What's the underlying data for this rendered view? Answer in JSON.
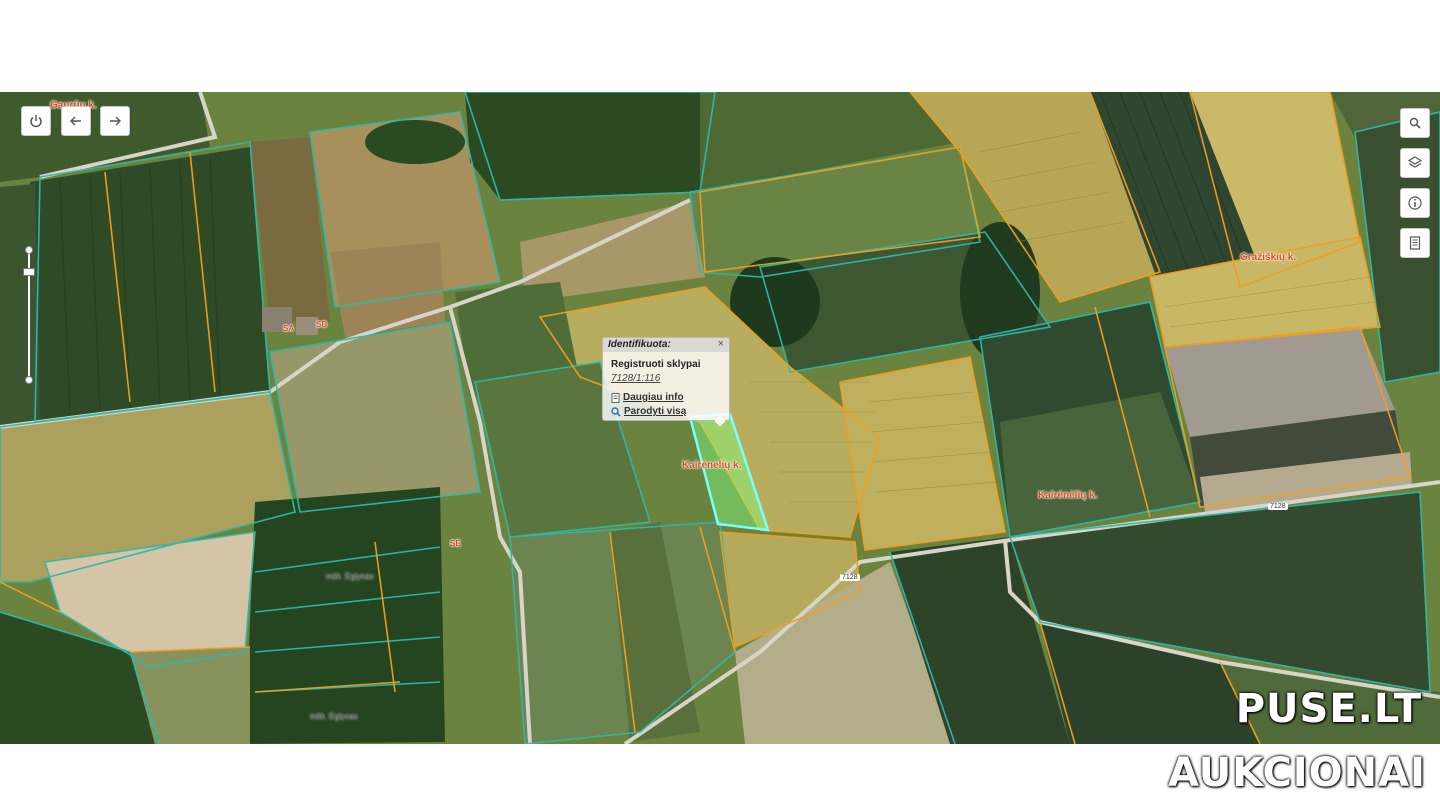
{
  "popup": {
    "header": "Identifikuota:",
    "close": "×",
    "title": "Registruoti sklypai",
    "parcel_id": "7128/1:116",
    "link_more": "Daugiau info",
    "link_show_all": "Parodyti visą"
  },
  "labels": {
    "village_top_left": "Gaurūų k.",
    "grazisku": "Gražiškių k.",
    "kairenelu_center": "Kairėnėlių k.",
    "kairenelu_right": "Kairėnėlių k.",
    "forest_1": "mšk. Eglynas",
    "forest_2": "mšk. Eglynas",
    "road_7128_a": "7128",
    "road_7128_b": "7128",
    "marker_a": "SA",
    "marker_b": "SB",
    "marker_c": "SE"
  },
  "brand": {
    "line1": "PUSE.LT",
    "line2": "AUKCIONAI"
  },
  "colors": {
    "parcel_border": "#2fb8a8",
    "cadastre_orange": "#f0a020",
    "selected": "#7fff7f",
    "label": "#e04a1a"
  },
  "controls": [
    "power-icon",
    "back-arrow-icon",
    "forward-arrow-icon",
    "search-icon",
    "layers-icon",
    "info-icon",
    "document-icon"
  ]
}
